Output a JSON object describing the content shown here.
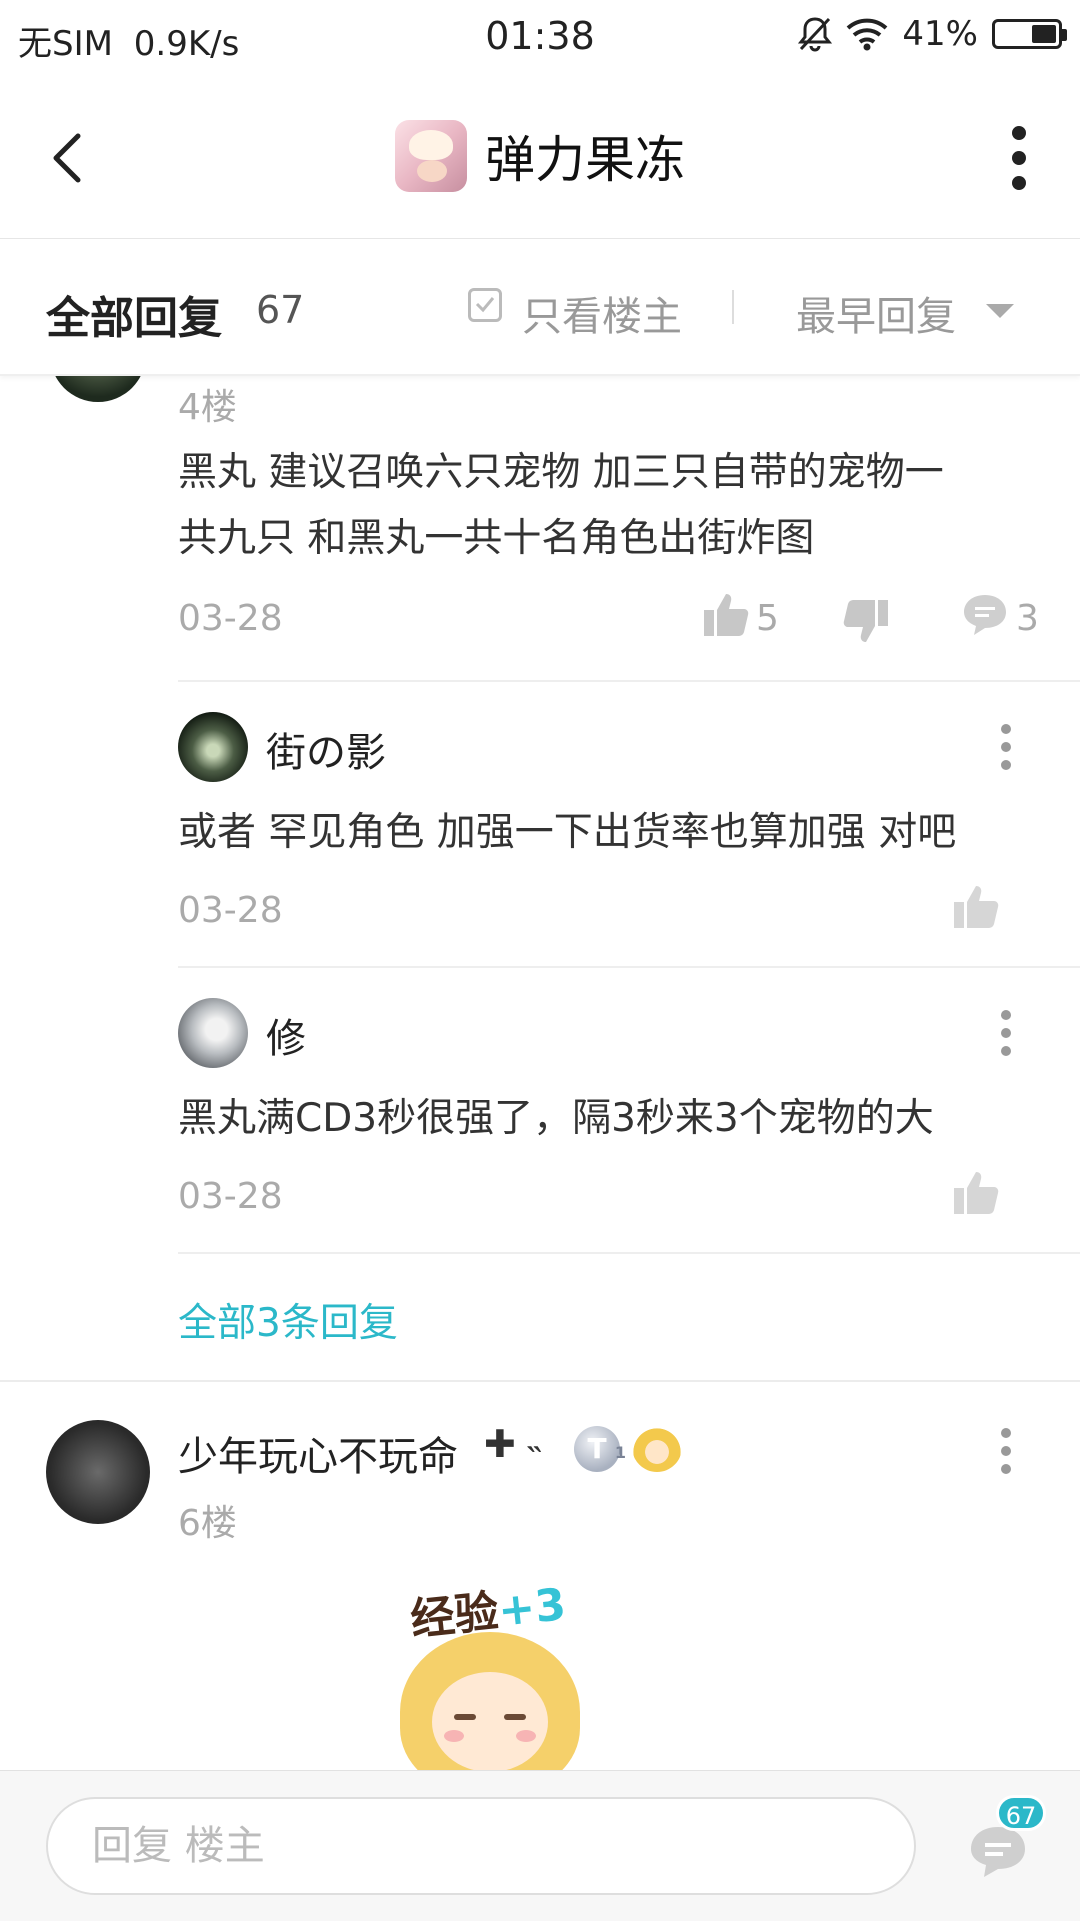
{
  "status_bar": {
    "carrier": "无SIM",
    "speed": "0.9K/s",
    "time": "01:38",
    "battery": "41%",
    "battery_level": 0.41,
    "icons": [
      "bell-off-icon",
      "wifi-icon",
      "battery-icon"
    ]
  },
  "header": {
    "title": "弹力果冻",
    "back_icon": "chevron-left-icon",
    "more_icon": "more-vertical-icon"
  },
  "filter_bar": {
    "all_replies_label": "全部回复",
    "count": "67",
    "owner_only_label": "只看楼主",
    "sort_label": "最早回复"
  },
  "post4": {
    "floor": "4楼",
    "content_line1": "黑丸 建议召唤六只宠物 加三只自带的宠物一",
    "content_line2": "共九只 和黑丸一共十名角色出街炸图",
    "date": "03-28",
    "likes": "5",
    "comments": "3"
  },
  "sub_replies": [
    {
      "username": "街の影",
      "content": "或者 罕见角色 加强一下出货率也算加强 对吧",
      "date": "03-28"
    },
    {
      "username": "修",
      "content": "黑丸满CD3秒很强了，隔3秒来3个宠物的大",
      "date": "03-28"
    }
  ],
  "view_all_replies": "全部3条回复",
  "post6": {
    "username": "少年玩心不玩命",
    "username_suffix": "✚ ˵",
    "floor": "6楼",
    "badge_letter": "T",
    "badge_level": "1",
    "sticker_text": "经验",
    "sticker_plus": "+3"
  },
  "bottom_bar": {
    "reply_placeholder": "回复  楼主",
    "message_count": "67"
  },
  "colors": {
    "accent": "#2bb8c9",
    "text_primary": "#222222",
    "text_secondary": "#aaaaaa"
  }
}
